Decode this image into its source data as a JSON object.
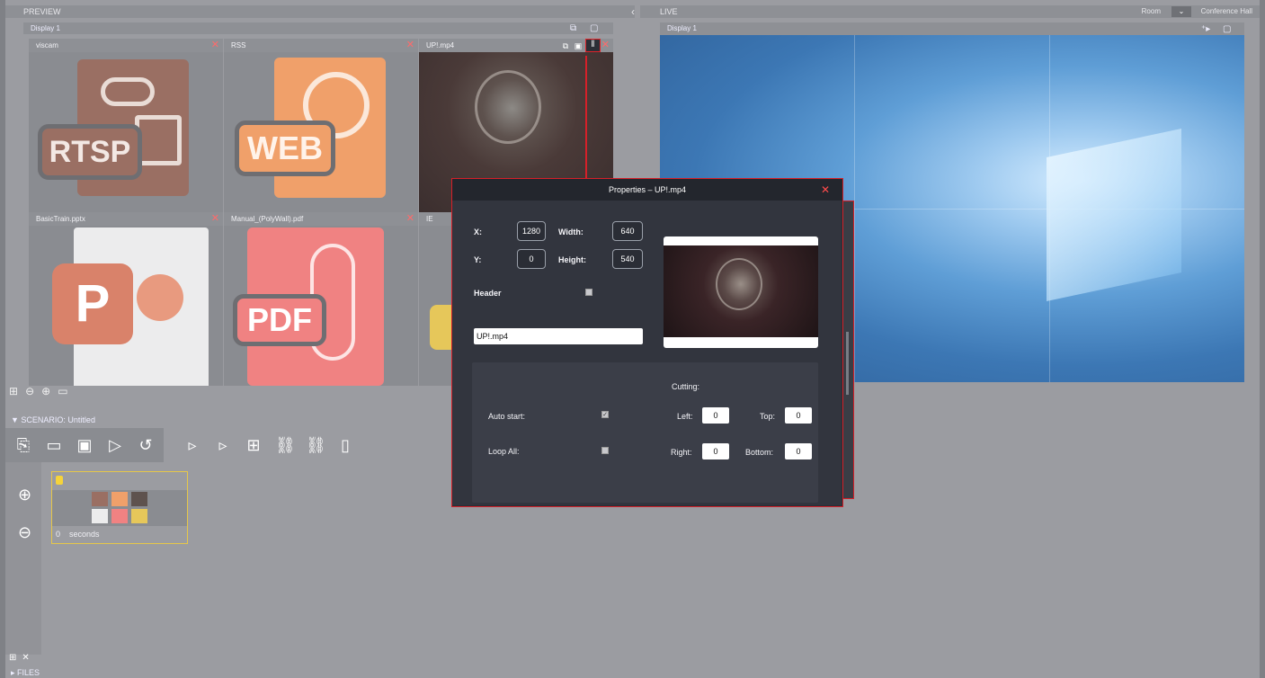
{
  "preview": {
    "header": "PREVIEW",
    "display_label": "Display 1",
    "tiles": [
      {
        "title": "viscam",
        "close": "✕",
        "badge": "RTSP"
      },
      {
        "title": "RSS",
        "close": "✕",
        "badge": "WEB"
      },
      {
        "title": "UP!.mp4",
        "close": "✕",
        "badge": ""
      },
      {
        "title": "BasicTrain.pptx",
        "close": "✕",
        "badge": "P"
      },
      {
        "title": "Manual_(PolyWall).pdf",
        "close": "✕",
        "badge": "PDF"
      },
      {
        "title": "IE",
        "close": "",
        "badge": ""
      }
    ]
  },
  "live": {
    "header": "LIVE",
    "room_label": "Room",
    "room_select": "⌄",
    "room_value": "Conference Hall",
    "display_label": "Display 1"
  },
  "collapse_arrow": "‹",
  "properties": {
    "title": "Properties – UP!.mp4",
    "close": "✕",
    "x_label": "X:",
    "x_value": "1280",
    "y_label": "Y:",
    "y_value": "0",
    "width_label": "Width:",
    "width_value": "640",
    "height_label": "Height:",
    "height_value": "540",
    "header_label": "Header",
    "header_value": "UP!.mp4",
    "cutting_label": "Cutting:",
    "auto_start_label": "Auto start:",
    "auto_start_checked": true,
    "loop_all_label": "Loop All:",
    "loop_all_checked": false,
    "left_label": "Left:",
    "left_value": "0",
    "top_label": "Top:",
    "top_value": "0",
    "right_label": "Right:",
    "right_value": "0",
    "bottom_label": "Bottom:",
    "bottom_value": "0"
  },
  "scenario": {
    "header": "SCENARIO: Untitled",
    "step_time": "0",
    "step_unit": "seconds"
  },
  "files": {
    "header": "FILES"
  }
}
